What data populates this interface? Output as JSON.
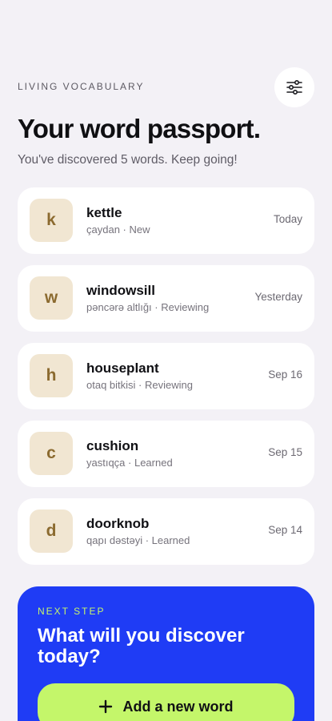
{
  "header": {
    "eyebrow": "LIVING VOCABULARY",
    "filter_icon": "sliders-icon"
  },
  "title": "Your word passport.",
  "subtitle": "You've discovered 5 words. Keep going!",
  "words": [
    {
      "initial": "k",
      "word": "kettle",
      "meta": "çaydan · New",
      "date": "Today"
    },
    {
      "initial": "w",
      "word": "windowsill",
      "meta": "pəncərə altlığı · Reviewing",
      "date": "Yesterday"
    },
    {
      "initial": "h",
      "word": "houseplant",
      "meta": "otaq bitkisi · Reviewing",
      "date": "Sep 16"
    },
    {
      "initial": "c",
      "word": "cushion",
      "meta": "yastıqça · Learned",
      "date": "Sep 15"
    },
    {
      "initial": "d",
      "word": "doorknob",
      "meta": "qapı dəstəyi · Learned",
      "date": "Sep 14"
    }
  ],
  "cta": {
    "eyebrow": "NEXT STEP",
    "title": "What will you discover today?",
    "button_label": "Add a new word",
    "button_icon": "plus-icon"
  },
  "colors": {
    "background": "#f3f1f6",
    "card": "#ffffff",
    "badge": "#f1e6d2",
    "badge_text": "#8b6a2f",
    "cta_background": "#1f3cf5",
    "accent_lime": "#c4f66a"
  }
}
